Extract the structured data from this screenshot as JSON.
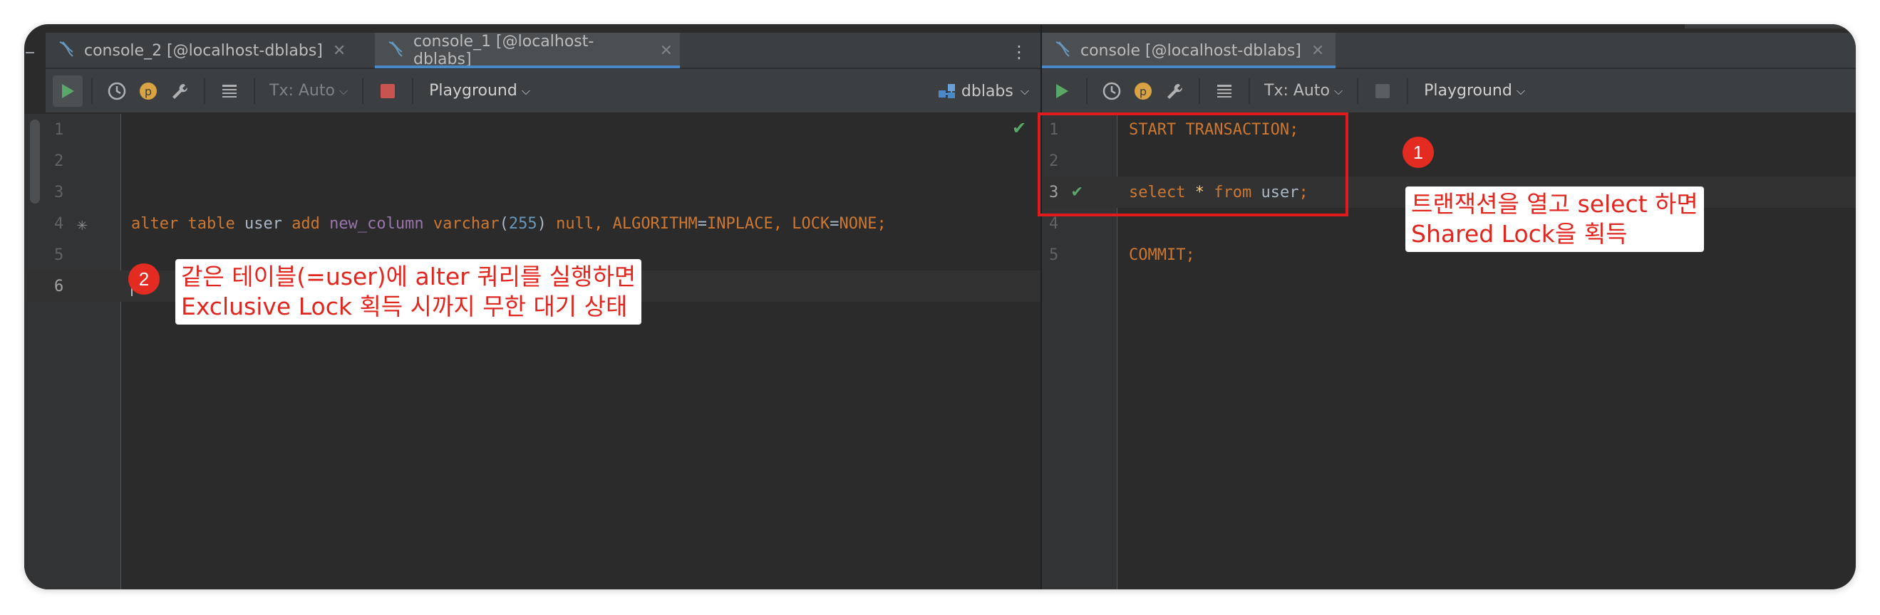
{
  "left_pane": {
    "tabs": [
      {
        "label": "console_2 [@localhost-dblabs]",
        "active": false
      },
      {
        "label": "console_1 [@localhost-dblabs]",
        "active": true
      }
    ],
    "toolbar": {
      "tx_label": "Tx: Auto",
      "playground_label": "Playground",
      "datasource_label": "dblabs",
      "p_badge": "p"
    },
    "lines": [
      "1",
      "2",
      "3",
      "4",
      "5",
      "6"
    ],
    "code_line4": {
      "t1": "alter table",
      "t2": " user ",
      "t3": "add",
      "t4": " new_column ",
      "t5": "varchar",
      "t6": "(",
      "t7": "255",
      "t8": ") ",
      "t9": "null, ALGORITHM",
      "t10": "=",
      "t11": "INPLACE, LOCK",
      "t12": "=",
      "t13": "NONE;"
    }
  },
  "right_pane": {
    "tabs": [
      {
        "label": "console [@localhost-dblabs]",
        "active": true
      }
    ],
    "toolbar": {
      "tx_label": "Tx: Auto",
      "playground_label": "Playground",
      "p_badge": "p"
    },
    "lines": [
      "1",
      "2",
      "3",
      "4",
      "5"
    ],
    "code": {
      "line1": "START TRANSACTION;",
      "line3_kw1": "select",
      "line3_star": " * ",
      "line3_kw2": "from",
      "line3_tbl": " user",
      "line3_semi": ";",
      "line5": "COMMIT;"
    }
  },
  "annotations": {
    "badge1": "1",
    "callout1": "트랜잭션을 열고 select 하면\nShared Lock을 획득",
    "badge2": "2",
    "callout2": "같은 테이블(=user)에 alter 쿼리를 실행하면\nExclusive Lock 획득 시까지 무한 대기 상태"
  },
  "colors": {
    "accent_tab": "#4a88c7",
    "annotation_red": "#e11b1b",
    "run_green": "#59a869",
    "keyword": "#cc7832"
  }
}
